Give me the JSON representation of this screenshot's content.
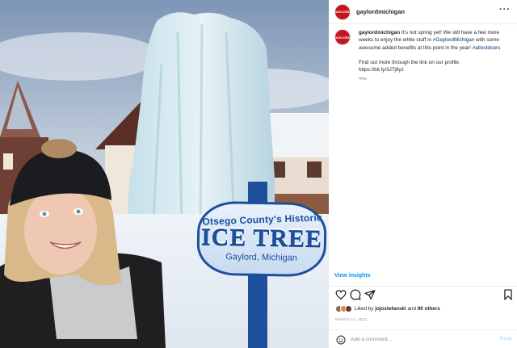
{
  "post": {
    "username": "gaylordmichigan",
    "avatar_text": "GAYLORD",
    "more_glyph": "···"
  },
  "photo": {
    "sign_top": "Otsego County's Historic",
    "sign_main": "ICE TREE",
    "sign_bottom": "Gaylord, Michigan"
  },
  "caption": {
    "username": "gaylordmichigan",
    "text_1": "It's not spring yet! We still have a few more weeks to enjoy the white stuff in ",
    "hashtag_1": "#GaylordMichigan",
    "text_2": " with some awesome added benefits at this point in the year! ",
    "hashtag_2": "#alloutdoors",
    "para_2_line_1": "Find out more through the link on our profile.",
    "para_2_line_2": "https://bit.ly/3J7j6yz",
    "time_ago": "44w"
  },
  "insights": {
    "label": "View insights"
  },
  "actions": [
    {
      "name": "like-icon"
    },
    {
      "name": "comment-icon"
    },
    {
      "name": "share-icon"
    },
    {
      "name": "save-icon"
    }
  ],
  "likes": {
    "prefix": "Liked by ",
    "user": "jojostefanski",
    "middle": " and ",
    "others": "90 others"
  },
  "date": "MARCH 11, 2022",
  "comment": {
    "placeholder": "Add a comment...",
    "post_label": "Post"
  },
  "colors": {
    "link": "#0095f6",
    "hashtag": "#00376b",
    "sign_blue": "#1d4f9c",
    "muted": "#8e8e8e"
  }
}
